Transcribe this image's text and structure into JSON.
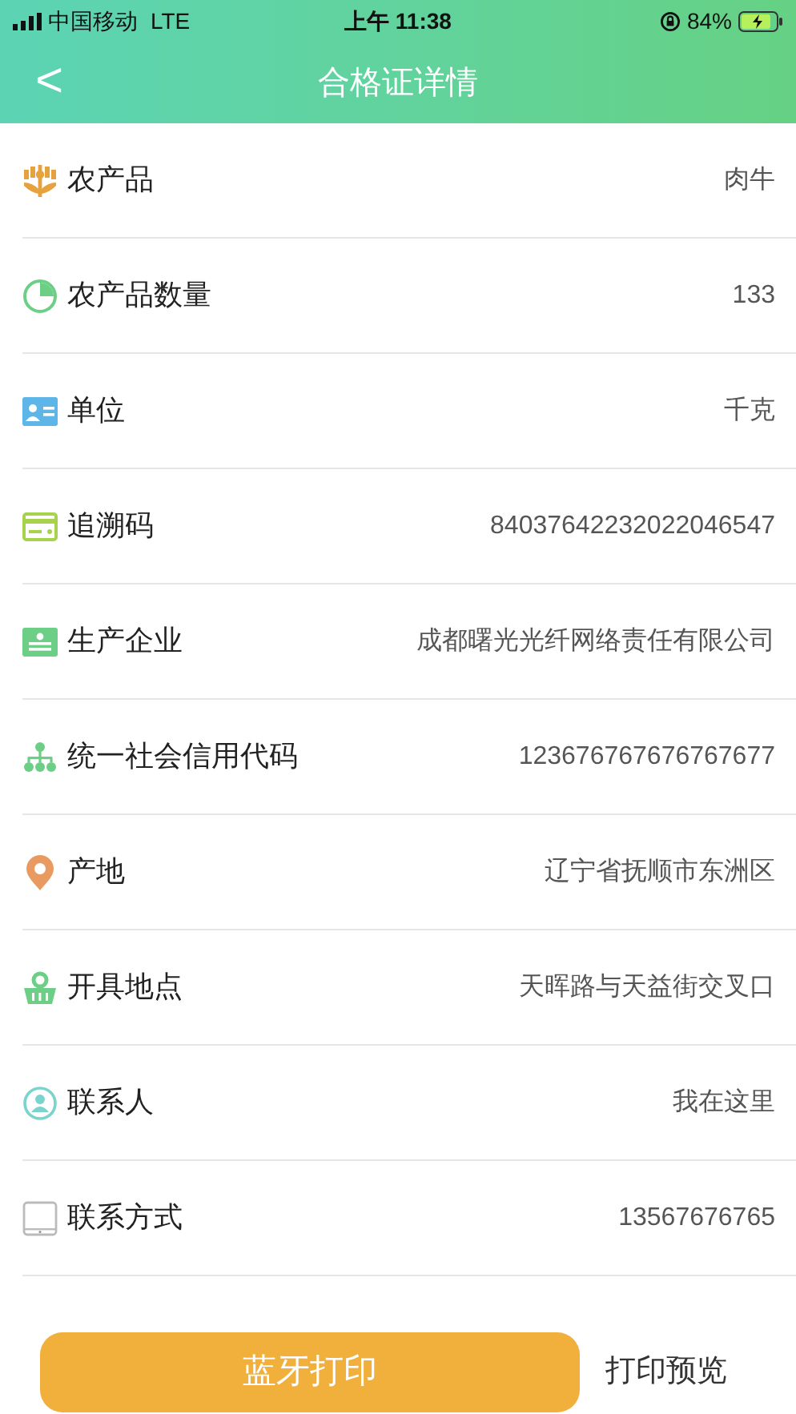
{
  "status_bar": {
    "carrier": "中国移动",
    "network": "LTE",
    "time": "上午 11:38",
    "battery": "84%"
  },
  "nav": {
    "back": "<",
    "title": "合格证详情"
  },
  "rows": [
    {
      "label": "农产品",
      "value": "肉牛"
    },
    {
      "label": "农产品数量",
      "value": "133"
    },
    {
      "label": "单位",
      "value": "千克"
    },
    {
      "label": "追溯码",
      "value": "84037642232022046547"
    },
    {
      "label": "生产企业",
      "value": "成都曙光光纤网络责任有限公司"
    },
    {
      "label": "统一社会信用代码",
      "value": "123676767676767677"
    },
    {
      "label": "产地",
      "value": "辽宁省抚顺市东洲区"
    },
    {
      "label": "开具地点",
      "value": "天晖路与天益街交叉口"
    },
    {
      "label": "联系人",
      "value": "我在这里"
    },
    {
      "label": "联系方式",
      "value": "13567676765"
    }
  ],
  "footer": {
    "print_button": "蓝牙打印",
    "preview_link": "打印预览"
  }
}
